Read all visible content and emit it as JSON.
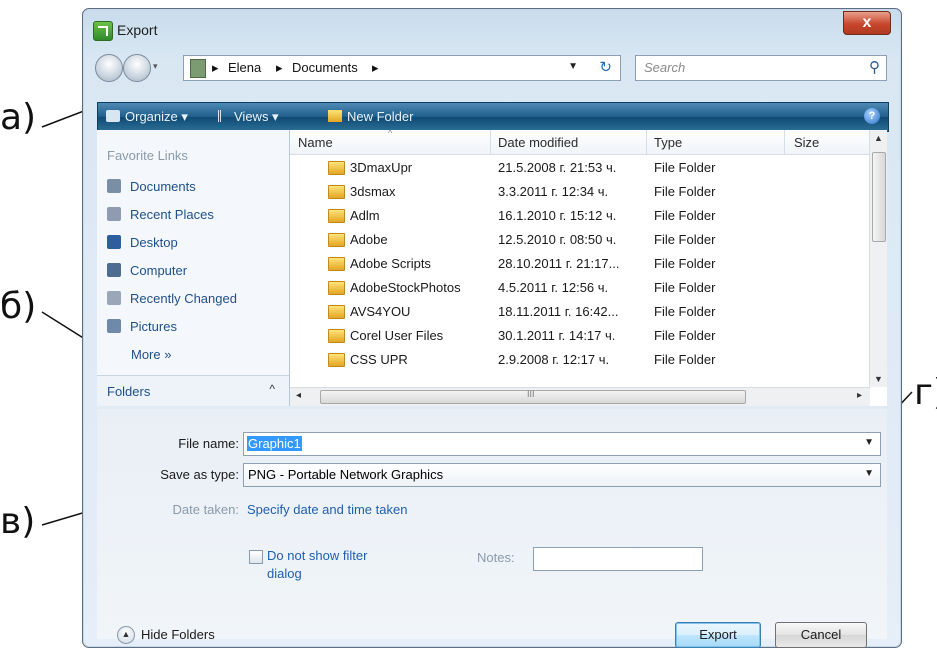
{
  "annotations": {
    "a": "а)",
    "b": "б)",
    "v": "в)",
    "g": "г)"
  },
  "window": {
    "title": "Export",
    "close_glyph": "x"
  },
  "nav": {
    "breadcrumb": [
      "Elena",
      "Documents"
    ],
    "separator": "▸",
    "search_placeholder": "Search"
  },
  "toolbar": {
    "organize": "Organize ▾",
    "views": "Views ▾",
    "new_folder": "New Folder"
  },
  "left_pane": {
    "heading": "Favorite Links",
    "links": [
      {
        "label": "Documents",
        "icon": "documents-icon",
        "color": "#7a8fa6"
      },
      {
        "label": "Recent Places",
        "icon": "recent-places-icon",
        "color": "#8f9bb0"
      },
      {
        "label": "Desktop",
        "icon": "desktop-icon",
        "color": "#2f5e9e"
      },
      {
        "label": "Computer",
        "icon": "computer-icon",
        "color": "#4d6c8f"
      },
      {
        "label": "Recently Changed",
        "icon": "recently-changed-icon",
        "color": "#9aa7b8"
      },
      {
        "label": "Pictures",
        "icon": "pictures-icon",
        "color": "#6f8aa8"
      }
    ],
    "more": "More »",
    "folders": "Folders",
    "folders_chevron": "^"
  },
  "file_list": {
    "columns": [
      "Name",
      "Date modified",
      "Type",
      "Size"
    ],
    "rows": [
      {
        "name": "3DmaxUpr",
        "date": "21.5.2008 г. 21:53 ч.",
        "type": "File Folder"
      },
      {
        "name": "3dsmax",
        "date": "3.3.2011 г. 12:34 ч.",
        "type": "File Folder"
      },
      {
        "name": "Adlm",
        "date": "16.1.2010 г. 15:12 ч.",
        "type": "File Folder"
      },
      {
        "name": "Adobe",
        "date": "12.5.2010 г. 08:50 ч.",
        "type": "File Folder"
      },
      {
        "name": "Adobe Scripts",
        "date": "28.10.2011 г. 21:17...",
        "type": "File Folder"
      },
      {
        "name": "AdobeStockPhotos",
        "date": "4.5.2011 г. 12:56 ч.",
        "type": "File Folder"
      },
      {
        "name": "AVS4YOU",
        "date": "18.11.2011 г. 16:42...",
        "type": "File Folder"
      },
      {
        "name": "Corel User Files",
        "date": "30.1.2011 г. 14:17 ч.",
        "type": "File Folder"
      },
      {
        "name": "CSS UPR",
        "date": "2.9.2008 г. 12:17 ч.",
        "type": "File Folder"
      }
    ],
    "hscroll_grip": "III"
  },
  "form": {
    "file_name_label": "File name:",
    "file_name_value": "Graphic1",
    "save_as_label": "Save as type:",
    "save_as_value": "PNG - Portable Network Graphics",
    "date_taken_label": "Date taken:",
    "date_taken_link": "Specify date and time taken",
    "checkbox_line1": "Do not show filter",
    "checkbox_line2": "dialog",
    "notes_label": "Notes:",
    "hide_folders": "Hide Folders",
    "export_button": "Export",
    "cancel_button": "Cancel"
  }
}
